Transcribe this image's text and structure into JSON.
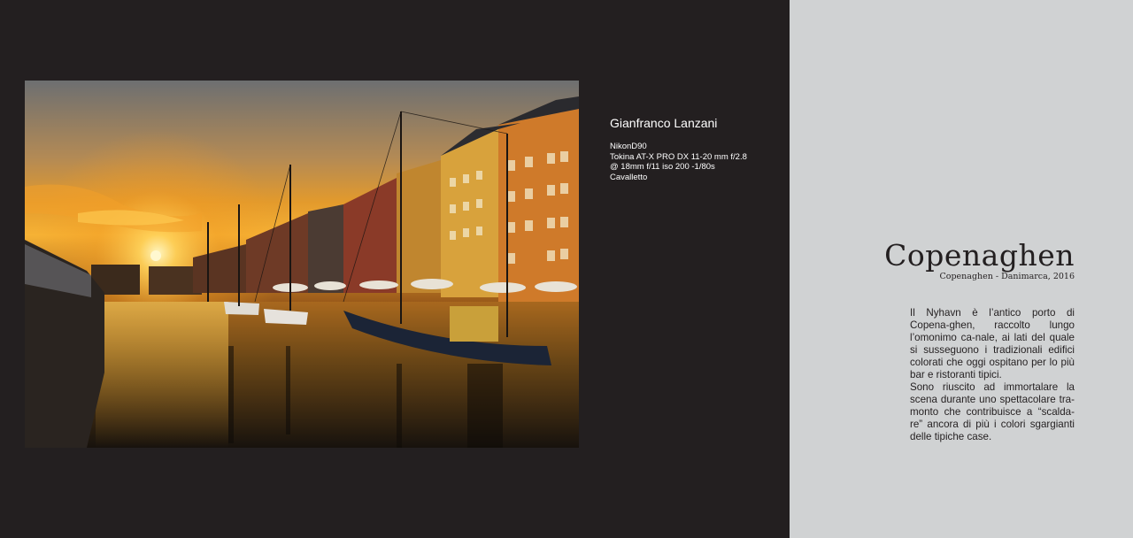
{
  "photo": {
    "subject": "Nyhavn canal at sunset",
    "colors": {
      "sky_top": "#6b6f73",
      "sky_glow": "#f0a324",
      "sun": "#fff2a8",
      "water": "#1a1510"
    }
  },
  "credits": {
    "author": "Gianfranco Lanzani",
    "specs": [
      "NikonD90",
      "Tokina AT-X PRO DX 11-20 mm f/2.8",
      "@ 18mm f/11 iso 200 -1/80s",
      "Cavalletto"
    ]
  },
  "article": {
    "title": "Copenaghen",
    "subtitle": "Copenaghen - Danimarca, 2016",
    "paragraphs": [
      "Il Nyhavn è l’antico porto di Copena-ghen, raccolto lungo l’omonimo ca-nale, ai lati del quale si susseguono i tradizionali edifici colorati che oggi ospitano per lo più bar e ristoranti tipici.",
      "Sono riuscito ad immortalare la scena durante uno spettacolare tra-monto che contribuisce a “scalda-re” ancora di più i colori sgargianti delle tipiche case."
    ]
  },
  "colors": {
    "left_page_bg": "#231f20",
    "right_page_bg": "#d0d2d3",
    "text_dark": "#231f20"
  }
}
